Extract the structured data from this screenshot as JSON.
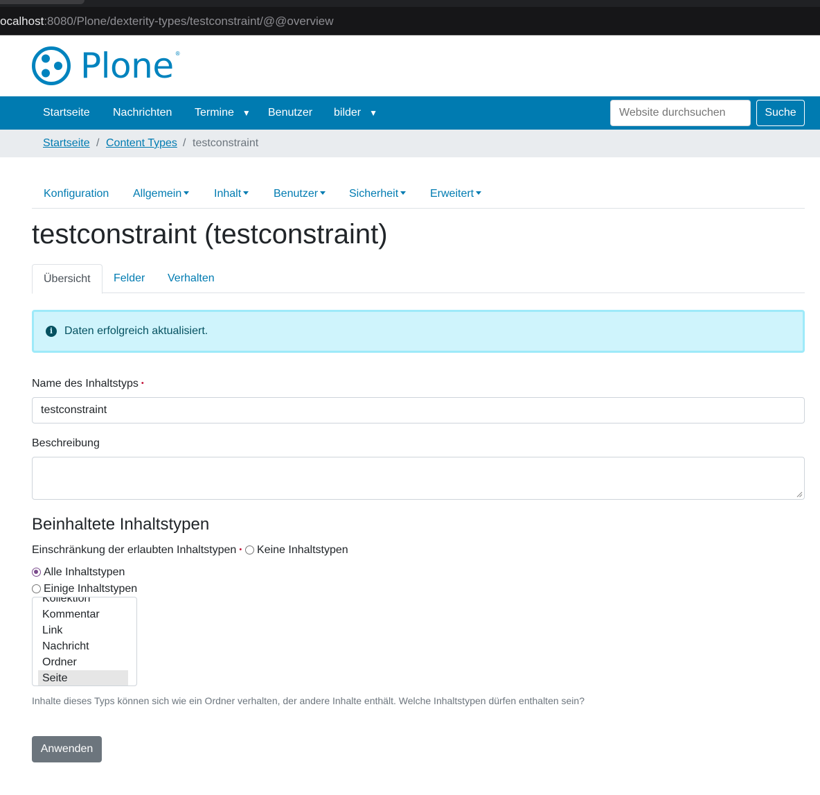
{
  "browser": {
    "url_host": "ocalhost",
    "url_rest": ":8080/Plone/dexterity-types/testconstraint/@@overview"
  },
  "logo": {
    "text": "Plone",
    "registered": "®",
    "icon": "plone-logo-icon"
  },
  "global_nav": {
    "items": [
      {
        "label": "Startseite",
        "dropdown": false
      },
      {
        "label": "Nachrichten",
        "dropdown": false
      },
      {
        "label": "Termine",
        "dropdown": true
      },
      {
        "label": "Benutzer",
        "dropdown": false
      },
      {
        "label": "bilder",
        "dropdown": true
      }
    ],
    "caret": "▼",
    "search_placeholder": "Website durchsuchen",
    "search_button": "Suche"
  },
  "breadcrumbs": {
    "items": [
      "Startseite",
      "Content Types"
    ],
    "separator": "/",
    "current": "testconstraint"
  },
  "control_panel_nav": {
    "items": [
      "Konfiguration",
      "Allgemein",
      "Inhalt",
      "Benutzer",
      "Sicherheit",
      "Erweitert"
    ]
  },
  "page_title": "testconstraint (testconstraint)",
  "tabs": [
    {
      "label": "Übersicht",
      "active": true
    },
    {
      "label": "Felder",
      "active": false
    },
    {
      "label": "Verhalten",
      "active": false
    }
  ],
  "alert": {
    "icon": "info-icon",
    "icon_glyph": "i",
    "text": "Daten erfolgreich aktualisiert."
  },
  "form": {
    "name_label": "Name des Inhaltstyps",
    "required_marker": "•",
    "name_value": "testconstraint",
    "description_label": "Beschreibung",
    "description_value": "",
    "section_title": "Beinhaltete Inhaltstypen",
    "constraint_label": "Einschränkung der erlaubten Inhaltstypen",
    "options": [
      {
        "label": "Keine Inhaltstypen",
        "checked": false
      },
      {
        "label": "Alle Inhaltstypen",
        "checked": true
      },
      {
        "label": "Einige Inhaltstypen",
        "checked": false
      }
    ],
    "listbox_items": [
      "Kollektion",
      "Kommentar",
      "Link",
      "Nachricht",
      "Ordner",
      "Seite"
    ],
    "listbox_selected": "Seite",
    "help_text": "Inhalte dieses Typs können sich wie ein Ordner verhalten, der andere Inhalte enthält. Welche Inhaltstypen dürfen enthalten sein?",
    "apply_button": "Anwenden"
  },
  "colors": {
    "brand": "#007bb1",
    "logo": "#0083be",
    "alert_bg": "#cff4fc",
    "alert_text": "#055160",
    "button_secondary": "#6c757d"
  }
}
